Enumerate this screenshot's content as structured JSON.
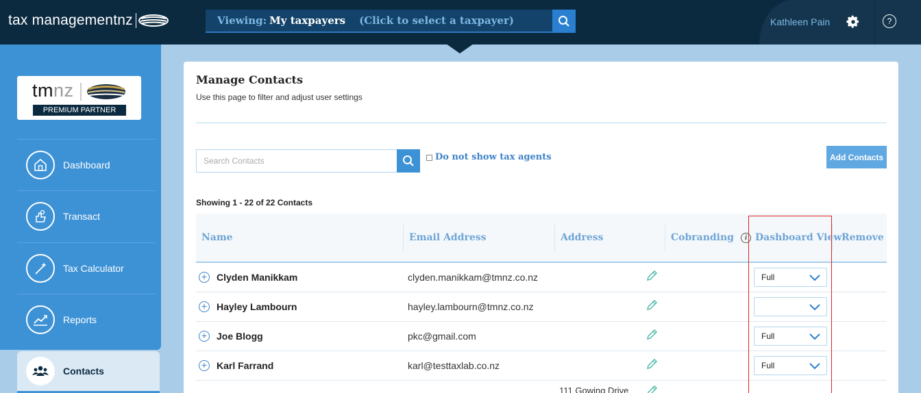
{
  "header": {
    "brand": "tax managementnz",
    "viewing_label": "Viewing:",
    "viewing_value": "My taxpayers",
    "viewing_hint": "(Click to select a taxpayer)",
    "user_name": "Kathleen Pain",
    "help_symbol": "?"
  },
  "sidebar": {
    "partner_logo_tm": "tm",
    "partner_logo_nz": "nz",
    "partner_badge": "PREMIUM PARTNER",
    "items": [
      {
        "label": "Dashboard",
        "icon": "home-icon"
      },
      {
        "label": "Transact",
        "icon": "hand-icon"
      },
      {
        "label": "Tax Calculator",
        "icon": "wand-icon"
      },
      {
        "label": "Reports",
        "icon": "chart-icon"
      },
      {
        "label": "Contacts",
        "icon": "people-icon",
        "active": true
      }
    ]
  },
  "main": {
    "title": "Manage Contacts",
    "subtitle": "Use this page to filter and adjust user settings",
    "search_placeholder": "Search Contacts",
    "checkbox_label": "Do not show tax agents",
    "add_button": "Add Contacts",
    "showing": "Showing 1 - 22 of 22 Contacts",
    "columns": {
      "name": "Name",
      "email": "Email Address",
      "address": "Address",
      "cobranding": "Cobranding",
      "info_symbol": "i",
      "dashboard_view": "Dashboard View",
      "remove": "Remove"
    },
    "rows": [
      {
        "name": "Clyden Manikkam",
        "email": "clyden.manikkam@tmnz.co.nz",
        "address": "",
        "dashboard_view": "Full"
      },
      {
        "name": "Hayley Lambourn",
        "email": "hayley.lambourn@tmnz.co.nz",
        "address": "",
        "dashboard_view": ""
      },
      {
        "name": "Joe Blogg",
        "email": "pkc@gmail.com",
        "address": "",
        "dashboard_view": "Full"
      },
      {
        "name": "Karl Farrand",
        "email": "karl@testtaxlab.co.nz",
        "address": "",
        "dashboard_view": "Full"
      },
      {
        "name": "",
        "email": "",
        "address": "111 Gowing Drive",
        "dashboard_view": ""
      }
    ]
  },
  "colors": {
    "topbar": "#0b2a40",
    "sidebar": "#3d92d6",
    "accent": "#2a7fd0",
    "highlight": "#e02020"
  }
}
